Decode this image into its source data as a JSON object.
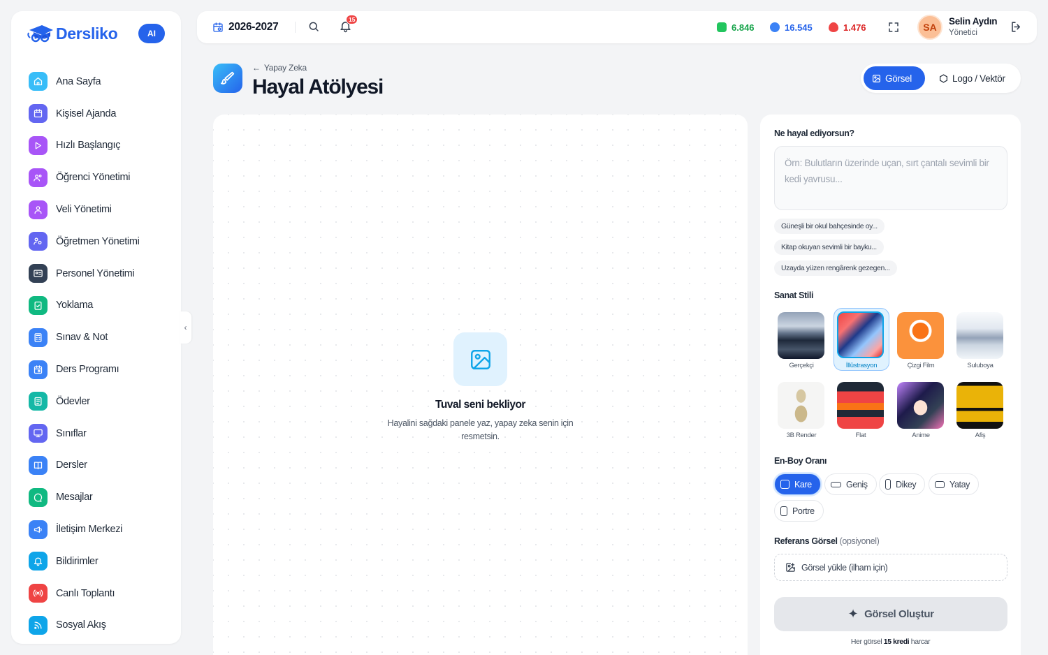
{
  "brand": {
    "name": "Dersliko",
    "ai_badge": "AI",
    "accent": "#2563eb"
  },
  "sidebar": {
    "items": [
      {
        "label": "Ana Sayfa",
        "icon": "home-icon",
        "color": "#38bdf8"
      },
      {
        "label": "Kişisel Ajanda",
        "icon": "calendar-icon",
        "color": "#6366f1"
      },
      {
        "label": "Hızlı Başlangıç",
        "icon": "play-icon",
        "color": "#a855f7"
      },
      {
        "label": "Öğrenci Yönetimi",
        "icon": "users-icon",
        "color": "#a855f7"
      },
      {
        "label": "Veli Yönetimi",
        "icon": "user-group-icon",
        "color": "#a855f7"
      },
      {
        "label": "Öğretmen Yönetimi",
        "icon": "teacher-icon",
        "color": "#6366f1"
      },
      {
        "label": "Personel Yönetimi",
        "icon": "id-card-icon",
        "color": "#334155"
      },
      {
        "label": "Yoklama",
        "icon": "clipboard-check-icon",
        "color": "#10b981"
      },
      {
        "label": "Sınav & Not",
        "icon": "calculator-icon",
        "color": "#3b82f6"
      },
      {
        "label": "Ders Programı",
        "icon": "schedule-icon",
        "color": "#3b82f6"
      },
      {
        "label": "Ödevler",
        "icon": "clipboard-icon",
        "color": "#14b8a6"
      },
      {
        "label": "Sınıflar",
        "icon": "monitor-icon",
        "color": "#6366f1"
      },
      {
        "label": "Dersler",
        "icon": "book-icon",
        "color": "#3b82f6"
      },
      {
        "label": "Mesajlar",
        "icon": "chat-icon",
        "color": "#10b981"
      },
      {
        "label": "İletişim Merkezi",
        "icon": "megaphone-icon",
        "color": "#3b82f6"
      },
      {
        "label": "Bildirimler",
        "icon": "bell-icon",
        "color": "#0ea5e9"
      },
      {
        "label": "Canlı Toplantı",
        "icon": "broadcast-icon",
        "color": "#ef4444"
      },
      {
        "label": "Sosyal Akış",
        "icon": "rss-icon",
        "color": "#0ea5e9"
      }
    ]
  },
  "topbar": {
    "year": "2026-2027",
    "notifications": "15",
    "stats": [
      {
        "value": "6.846",
        "color": "#16a34a",
        "icon": "coin-icon"
      },
      {
        "value": "16.545",
        "color": "#2563eb",
        "icon": "gem-icon"
      },
      {
        "value": "1.476",
        "color": "#dc2626",
        "icon": "flame-icon"
      }
    ],
    "user": {
      "initials": "SA",
      "name": "Selin Aydın",
      "role": "Yönetici"
    }
  },
  "page": {
    "breadcrumb": "Yapay Zeka",
    "title": "Hayal Atölyesi"
  },
  "modes": [
    {
      "label": "Görsel"
    },
    {
      "label": "Logo / Vektör"
    }
  ],
  "canvas": {
    "empty_title": "Tuval seni bekliyor",
    "empty_sub": "Hayalini sağdaki panele yaz, yapay zeka senin için resmetsin."
  },
  "panel": {
    "prompt_label": "Ne hayal ediyorsun?",
    "prompt_placeholder": "Örn: Bulutların üzerinde uçan, sırt çantalı sevimli bir kedi yavrusu...",
    "suggestions": [
      "Güneşli bir okul bahçesinde oy...",
      "Kitap okuyan sevimli bir bayku...",
      "Uzayda yüzen rengârenk gezegen..."
    ],
    "style_label": "Sanat Stili",
    "styles": [
      "Gerçekçi",
      "İllüstrasyon",
      "Çizgi Film",
      "Suluboya",
      "3B Render",
      "Flat",
      "Anime",
      "Afiş"
    ],
    "ratio_label": "En-Boy Oranı",
    "ratios": [
      "Kare",
      "Geniş",
      "Dikey",
      "Yatay",
      "Portre"
    ],
    "ref_label": "Referans Görsel",
    "ref_optional": "(opsiyonel)",
    "upload_label": "Görsel yükle (ilham için)",
    "generate_label": "Görsel Oluştur",
    "credit_prefix": "Her görsel ",
    "credit_amount": "15 kredi",
    "credit_suffix": " harcar"
  }
}
